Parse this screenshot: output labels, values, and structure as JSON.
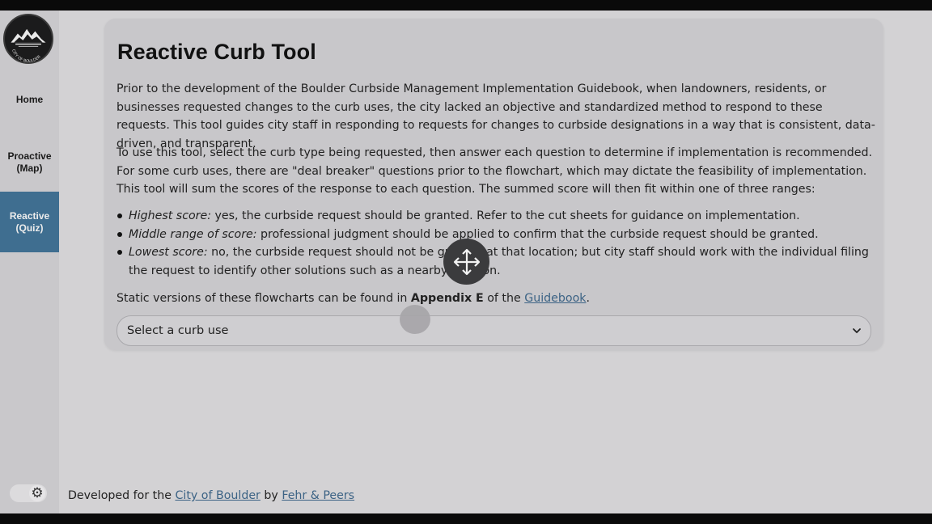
{
  "sidebar": {
    "logo_alt": "CITY OF BOULDER",
    "items": [
      {
        "label": "Home"
      },
      {
        "label_line1": "Proactive",
        "label_line2": "(Map)"
      },
      {
        "label_line1": "Reactive",
        "label_line2": "(Quiz)",
        "active": true
      }
    ],
    "theme_toggle_icon": "gear-icon"
  },
  "main": {
    "title": "Reactive Curb Tool",
    "paragraph1": "Prior to the development of the Boulder Curbside Management Implementation Guidebook, when landowners, residents, or businesses requested changes to the curb uses, the city lacked an objective and standardized method to respond to these requests. This tool guides city staff in responding to requests for changes to curbside designations in a way that is consistent, data-driven, and transparent.",
    "paragraph2": "To use this tool, select the curb type being requested, then answer each question to determine if implementation is recommended. For some curb uses, there are \"deal breaker\" questions prior to the flowchart, which may dictate the feasibility of implementation. This tool will sum the scores of the response to each question. The summed score will then fit within one of three ranges:",
    "bullets": [
      {
        "term": "Highest score:",
        "text": " yes, the curbside request should be granted. Refer to the cut sheets for guidance on implementation."
      },
      {
        "term": "Middle range of score:",
        "text": " professional judgment should be applied to confirm that the curbside request should be granted."
      },
      {
        "term": "Lowest score:",
        "text": " no, the curbside request should not be granted at that location; but city staff should work with the individual filing the request to identify other solutions such as a nearby location."
      }
    ],
    "static_prefix": "Static versions of these flowcharts can be found in ",
    "static_bold": "Appendix E",
    "static_middle": " of the ",
    "static_link": "Guidebook",
    "static_suffix": ".",
    "select_placeholder": "Select a curb use"
  },
  "footer": {
    "prefix": "Developed for the ",
    "link1": "City of Boulder",
    "middle": " by ",
    "link2": "Fehr & Peers"
  },
  "colors": {
    "active_nav": "#3f6e90",
    "link": "#3c6385",
    "background": "#d3d2d4"
  }
}
